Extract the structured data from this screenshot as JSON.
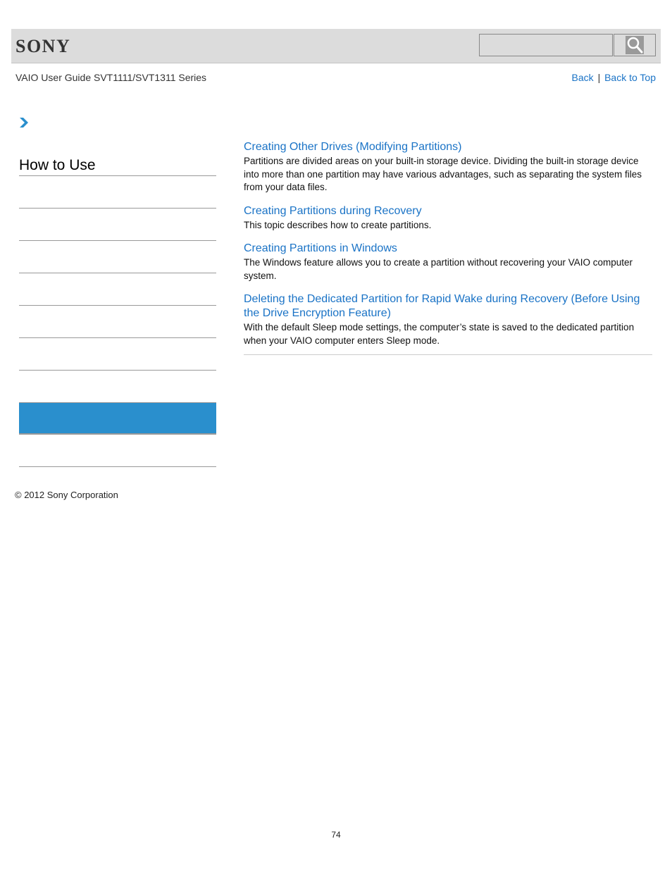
{
  "header": {
    "brand": "SONY",
    "search": {
      "value": "",
      "placeholder": ""
    },
    "search_icon": "magnifier-icon"
  },
  "nav": {
    "guide_title": "VAIO User Guide SVT1111/SVT1311 Series",
    "back_label": "Back",
    "separator": "|",
    "back_to_top_label": "Back to Top"
  },
  "breadcrumb": {
    "icon": "chevron-right-icon"
  },
  "sidebar": {
    "title": "How to Use",
    "items": [
      {
        "label": "",
        "active": false
      },
      {
        "label": "",
        "active": false
      },
      {
        "label": "",
        "active": false
      },
      {
        "label": "",
        "active": false
      },
      {
        "label": "",
        "active": false
      },
      {
        "label": "",
        "active": false
      },
      {
        "label": "",
        "active": false
      },
      {
        "label": "",
        "active": true
      },
      {
        "label": "",
        "active": false
      }
    ]
  },
  "topics": [
    {
      "title": "Creating Other Drives (Modifying Partitions)",
      "description": "Partitions are divided areas on your built-in storage device. Dividing the built-in storage device into more than one partition may have various advantages, such as separating the system files from your data files."
    },
    {
      "title": "Creating Partitions during Recovery",
      "description": "This topic describes how to create partitions."
    },
    {
      "title": "Creating Partitions in Windows",
      "description": "The Windows feature allows you to create a partition without recovering your VAIO computer system."
    },
    {
      "title": "Deleting the Dedicated Partition for Rapid Wake during Recovery (Before Using the Drive Encryption Feature)",
      "description": "With the default Sleep mode settings, the computer’s state is saved to the dedicated partition when your VAIO computer enters Sleep mode."
    }
  ],
  "footer": {
    "copyright": "© 2012 Sony Corporation",
    "page_number": "74"
  },
  "colors": {
    "link": "#1a73c6",
    "active_item": "#2a8fcd",
    "header_bg": "#dcdcdc"
  }
}
